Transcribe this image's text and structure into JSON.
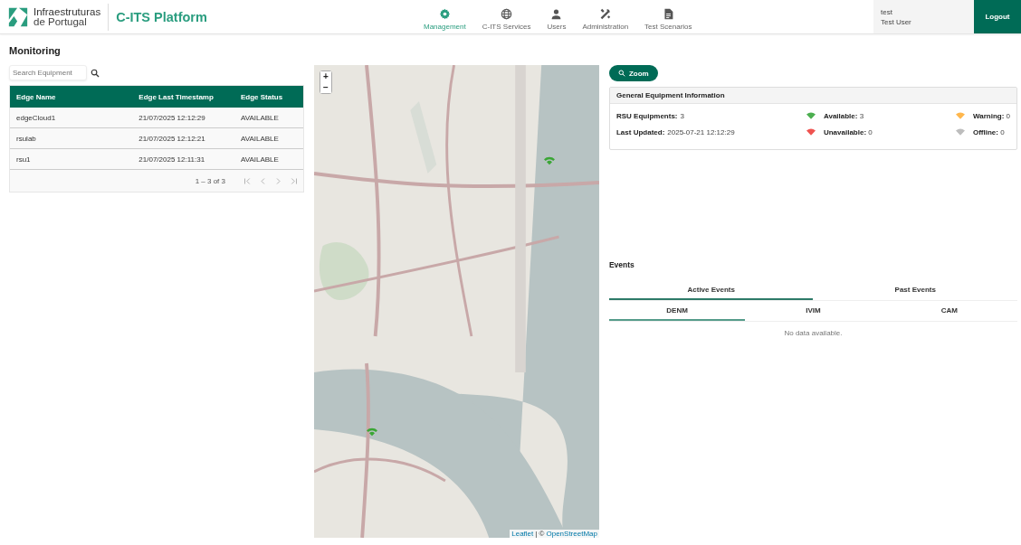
{
  "brand": {
    "line_1": "Infraestruturas",
    "line_2": "de Portugal",
    "app_title": "C-ITS Platform"
  },
  "nav": [
    {
      "label": "Management",
      "selected": true
    },
    {
      "label": "C-ITS Services",
      "selected": false
    },
    {
      "label": "Users",
      "selected": false
    },
    {
      "label": "Administration",
      "selected": false
    },
    {
      "label": "Test Scenarios",
      "selected": false
    }
  ],
  "user": {
    "username": "test",
    "full_name": "Test User",
    "logout": "Logout"
  },
  "page_title": "Monitoring",
  "search": {
    "placeholder": "Search Equipment"
  },
  "table": {
    "columns": [
      "Edge Name",
      "Edge Last Timestamp",
      "Edge Status"
    ],
    "rows": [
      [
        "edgeCloud1",
        "21/07/2025 12:12:29",
        "AVAILABLE"
      ],
      [
        "rsulab",
        "21/07/2025 12:12:21",
        "AVAILABLE"
      ],
      [
        "rsu1",
        "21/07/2025 12:11:31",
        "AVAILABLE"
      ]
    ],
    "range": "1 – 3 of 3"
  },
  "map": {
    "zoom_in": "+",
    "zoom_out": "−",
    "attribution_link_1": "Leaflet",
    "attribution_separator": "| ©",
    "attribution_link_2": "OpenStreetMap"
  },
  "zoom_button": "Zoom",
  "equipment_info": {
    "title": "General Equipment Information",
    "rsu_label": "RSU Equipments:",
    "rsu_value": "3",
    "updated_label": "Last Updated:",
    "updated_value": "2025-07-21 12:12:29",
    "statuses": [
      {
        "label": "Available:",
        "value": "3",
        "color": "#4caf50"
      },
      {
        "label": "Warning:",
        "value": "0",
        "color": "#ffb74d"
      },
      {
        "label": "Unavailable:",
        "value": "0",
        "color": "#ef5350"
      },
      {
        "label": "Offline:",
        "value": "0",
        "color": "#bdbdbd"
      }
    ]
  },
  "events": {
    "title": "Events",
    "tabs": [
      {
        "label": "Active Events",
        "selected": true
      },
      {
        "label": "Past Events",
        "selected": false
      }
    ],
    "subtabs": [
      {
        "label": "DENM",
        "selected": true
      },
      {
        "label": "IVIM",
        "selected": false
      },
      {
        "label": "CAM",
        "selected": false
      }
    ],
    "empty": "No data available."
  }
}
